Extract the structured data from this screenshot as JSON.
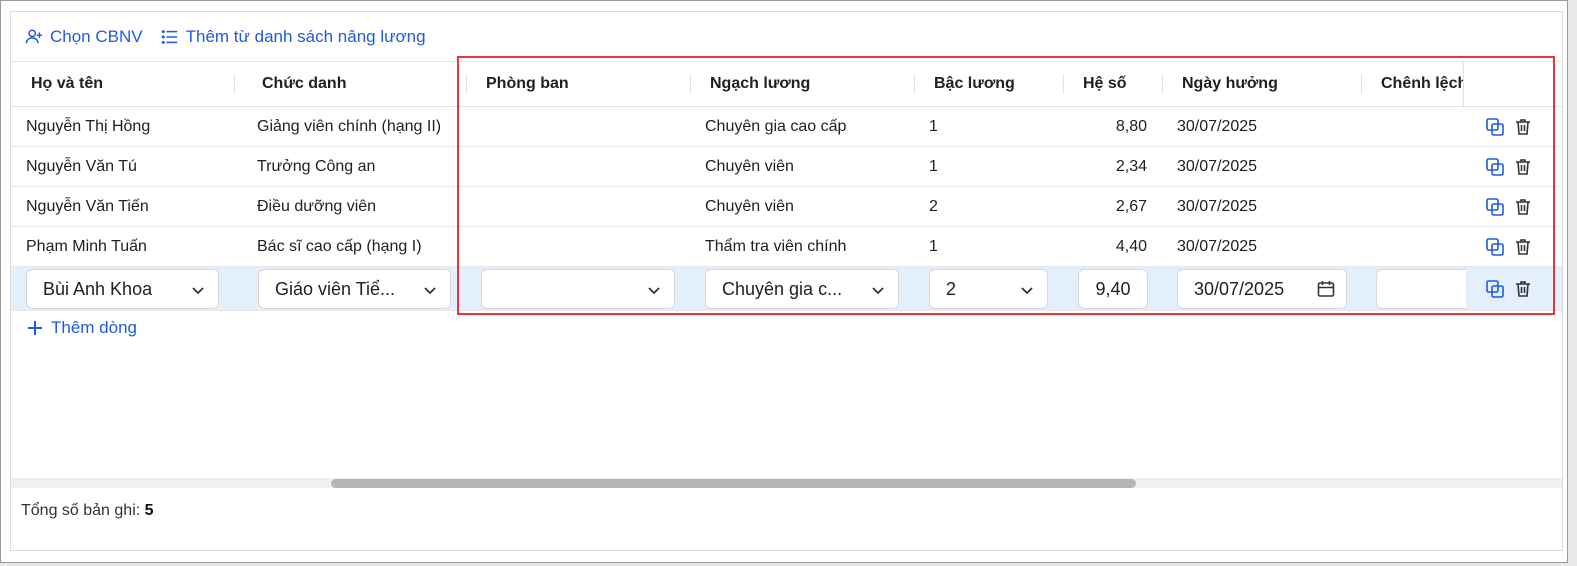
{
  "toolbar": {
    "choose_label": "Chọn CBNV",
    "add_from_list_label": "Thêm từ danh sách nâng lương"
  },
  "columns": [
    "Họ và tên",
    "Chức danh",
    "Phòng ban",
    "Ngạch lương",
    "Bậc lương",
    "Hệ số",
    "Ngày hưởng",
    "Chênh lệch"
  ],
  "rows": [
    {
      "name": "Nguyễn Thị Hồng",
      "title": "Giảng viên chính (hạng II)",
      "dept": "",
      "grade": "Chuyên gia cao cấp",
      "level": "1",
      "coef": "8,80",
      "date": "30/07/2025"
    },
    {
      "name": "Nguyễn Văn Tú",
      "title": "Trưởng Công an",
      "dept": "",
      "grade": "Chuyên viên",
      "level": "1",
      "coef": "2,34",
      "date": "30/07/2025"
    },
    {
      "name": "Nguyễn Văn Tiến",
      "title": "Điều dưỡng viên",
      "dept": "",
      "grade": "Chuyên viên",
      "level": "2",
      "coef": "2,67",
      "date": "30/07/2025"
    },
    {
      "name": "Phạm Minh Tuấn",
      "title": "Bác sĩ cao cấp (hạng I)",
      "dept": "",
      "grade": "Thẩm tra viên chính",
      "level": "1",
      "coef": "4,40",
      "date": "30/07/2025"
    }
  ],
  "edit_row": {
    "name": "Bùi Anh Khoa",
    "title": "Giáo viên Tiể...",
    "dept": "",
    "grade": "Chuyên gia c...",
    "level": "2",
    "coef": "9,40",
    "date": "30/07/2025",
    "diff": ""
  },
  "add_row_label": "Thêm dòng",
  "footer": {
    "label": "Tổng số bản ghi:",
    "count": "5"
  },
  "colors": {
    "accent": "#1f5be0",
    "edit_row_bg": "#e3f0fc",
    "highlight": "#e8343a"
  }
}
